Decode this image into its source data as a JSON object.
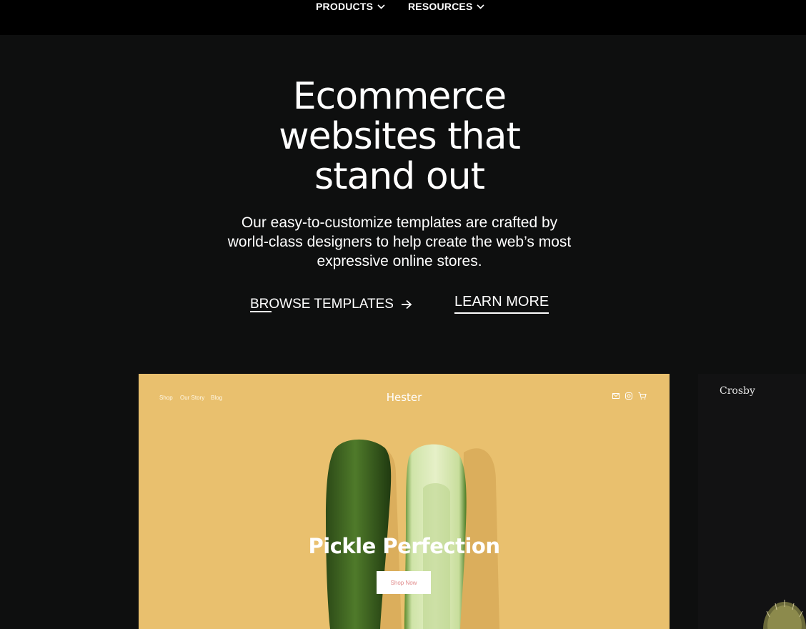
{
  "nav": {
    "items": [
      {
        "label": "PRODUCTS"
      },
      {
        "label": "RESOURCES"
      }
    ]
  },
  "hero": {
    "title_lines": [
      "Ecommerce",
      "websites that",
      "stand out"
    ],
    "subtitle_lines": [
      "Our easy-to-customize templates are crafted by",
      "world-class designers to help create the web’s most",
      "expressive online stores."
    ],
    "primary_cta": "BROWSE TEMPLATES",
    "secondary_cta": "LEARN MORE"
  },
  "templates": [
    {
      "logo": "Hester",
      "nav": [
        "Shop",
        "Our Story",
        "Blog"
      ],
      "headline": "Pickle Perfection",
      "cta": "Shop Now",
      "bg_color": "#e9c06e"
    },
    {
      "logo": "Crosby",
      "bg_color": "#121213"
    }
  ]
}
